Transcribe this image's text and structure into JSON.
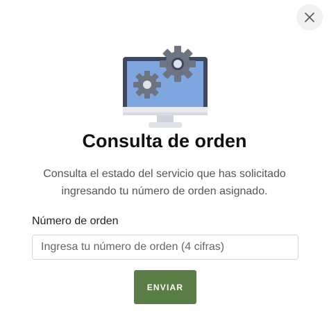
{
  "dialog": {
    "title": "Consulta de orden",
    "description": "Consulta el estado del servicio que has solicitado ingresando tu número de orden asignado.",
    "close_icon": "close-icon",
    "illustration_icon": "monitor-gears-icon"
  },
  "form": {
    "order_label": "Número de orden",
    "order_placeholder": "Ingresa tu número de orden (4 cifras)",
    "order_value": "",
    "submit_label": "ENVIAR"
  },
  "colors": {
    "submit_button": "#5a7c45",
    "close_button_bg": "#f1f1f1",
    "monitor_screen": "#7fa6de",
    "monitor_frame": "#3e4a5b",
    "gear": "#6b7480"
  }
}
